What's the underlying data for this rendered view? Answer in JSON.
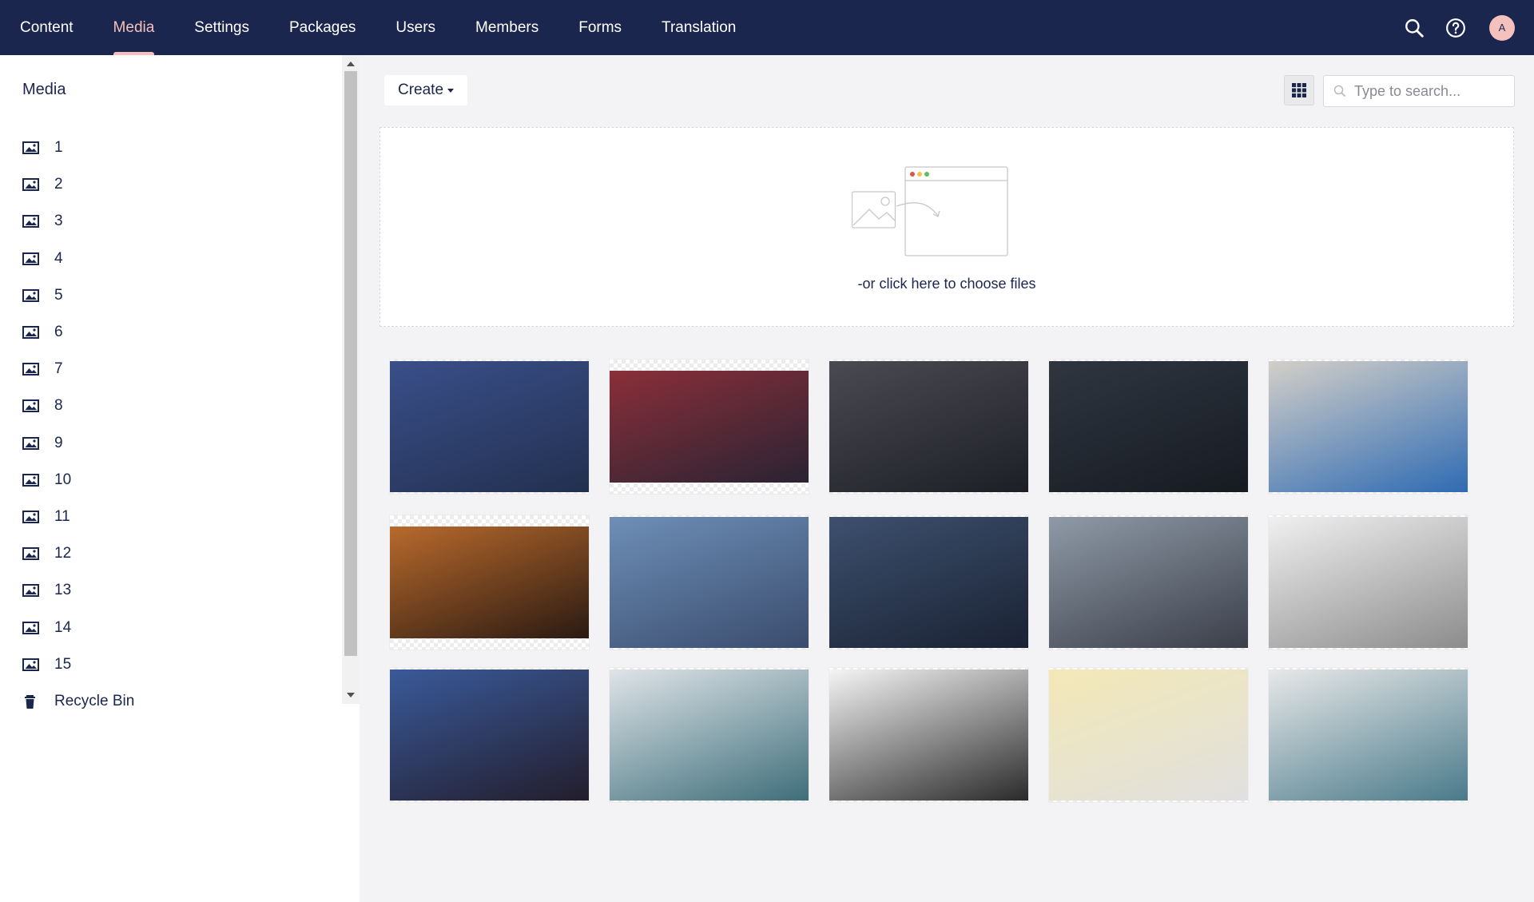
{
  "nav": {
    "items": [
      {
        "label": "Content",
        "active": false
      },
      {
        "label": "Media",
        "active": true
      },
      {
        "label": "Settings",
        "active": false
      },
      {
        "label": "Packages",
        "active": false
      },
      {
        "label": "Users",
        "active": false
      },
      {
        "label": "Members",
        "active": false
      },
      {
        "label": "Forms",
        "active": false
      },
      {
        "label": "Translation",
        "active": false
      }
    ],
    "avatar_initial": "A",
    "icons": [
      "search-icon",
      "help-icon"
    ]
  },
  "tree": {
    "title": "Media",
    "items": [
      "1",
      "2",
      "3",
      "4",
      "5",
      "6",
      "7",
      "8",
      "9",
      "10",
      "11",
      "12",
      "13",
      "14",
      "15"
    ],
    "recycle_bin": "Recycle Bin"
  },
  "toolbar": {
    "create_label": "Create",
    "search_placeholder": "Type to search..."
  },
  "dropzone": {
    "text": "-or click here to choose files"
  },
  "media": {
    "items": [
      {
        "name": "1",
        "colors": [
          "#3a4f8a",
          "#22304f"
        ]
      },
      {
        "name": "2",
        "colors": [
          "#8a2f3a",
          "#2a2332"
        ]
      },
      {
        "name": "3",
        "colors": [
          "#4a4a52",
          "#1d1f26"
        ]
      },
      {
        "name": "4",
        "colors": [
          "#2f3640",
          "#161b22"
        ]
      },
      {
        "name": "5",
        "colors": [
          "#d4cfc8",
          "#2f6bb3"
        ]
      },
      {
        "name": "6",
        "colors": [
          "#b86a2c",
          "#2a1a12"
        ]
      },
      {
        "name": "7",
        "colors": [
          "#6e8fb6",
          "#3a4c6e"
        ]
      },
      {
        "name": "8",
        "colors": [
          "#3d506e",
          "#1a2233"
        ]
      },
      {
        "name": "9",
        "colors": [
          "#8e9aa6",
          "#3b3f4a"
        ]
      },
      {
        "name": "10",
        "colors": [
          "#f0f0f0",
          "#8c8c8c"
        ]
      },
      {
        "name": "11",
        "colors": [
          "#3a5a99",
          "#231d2c"
        ]
      },
      {
        "name": "12",
        "colors": [
          "#dfe4e8",
          "#3f6e7a"
        ]
      },
      {
        "name": "13",
        "colors": [
          "#f5f5f5",
          "#2a2a2a"
        ]
      },
      {
        "name": "14",
        "colors": [
          "#f3e8b6",
          "#e0e0e0"
        ]
      },
      {
        "name": "15",
        "colors": [
          "#e8e8e8",
          "#4a7a8a"
        ]
      }
    ]
  },
  "colors": {
    "topbar": "#1b264f",
    "accent": "#f5c1bc"
  }
}
